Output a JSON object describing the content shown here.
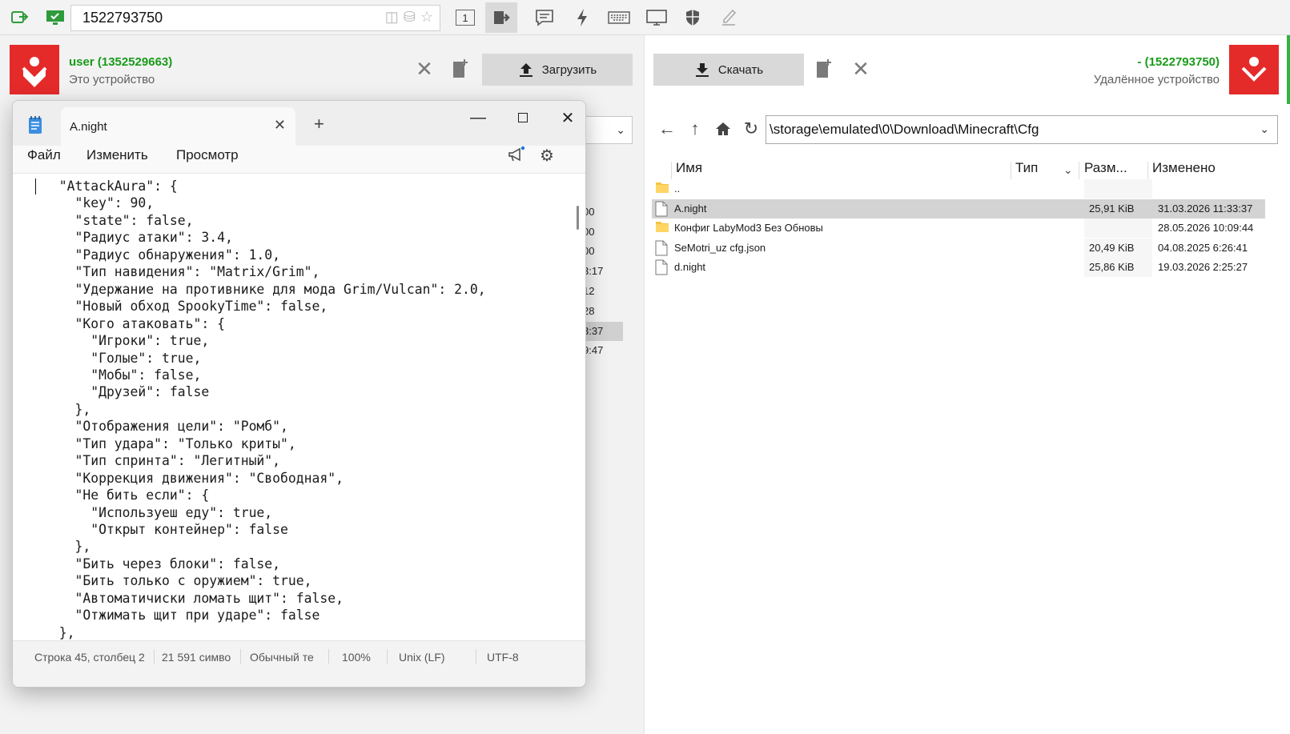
{
  "toolbar": {
    "remote_id": "1522793750",
    "icons": [
      "connection-status-icon",
      "monitor-icon",
      "screen-icon",
      "disk-icon",
      "star-icon",
      "session-number-icon",
      "file-transfer-icon",
      "chat-icon",
      "action-icon",
      "keyboard-icon",
      "display-icon",
      "shield-icon",
      "pen-icon"
    ],
    "session_number": "1"
  },
  "local": {
    "device_name": "user (1352529663)",
    "device_sub": "Это устройство",
    "upload_label": "Загрузить",
    "partial_times": [
      "00",
      "00",
      "00",
      "3:17",
      "12",
      "28",
      "3:37",
      "9:47"
    ]
  },
  "remote": {
    "device_name": "- (1522793750)",
    "device_sub": "Удалённое устройство",
    "download_label": "Скачать",
    "path": "\\storage\\emulated\\0\\Download\\Minecraft\\Cfg",
    "columns": {
      "name": "Имя",
      "type": "Тип",
      "size": "Разм...",
      "modified": "Изменено"
    },
    "files": [
      {
        "name": "..",
        "kind": "folder",
        "size": "",
        "modified": ""
      },
      {
        "name": "A.night",
        "kind": "file",
        "size": "25,91 KiB",
        "modified": "31.03.2026 11:33:37",
        "selected": true
      },
      {
        "name": "Конфиг LabyMod3 Без Обновы",
        "kind": "folder",
        "size": "",
        "modified": "28.05.2026 10:09:44"
      },
      {
        "name": "SeMotri_uz cfg.json",
        "kind": "file",
        "size": "20,49 KiB",
        "modified": "04.08.2025 6:26:41"
      },
      {
        "name": "d.night",
        "kind": "file",
        "size": "25,86 KiB",
        "modified": "19.03.2026 2:25:27"
      }
    ]
  },
  "notepad": {
    "tab_title": "A.night",
    "menu": {
      "file": "Файл",
      "edit": "Изменить",
      "view": "Просмотр"
    },
    "lines": [
      "  \"AttackAura\": {",
      "    \"key\": 90,",
      "    \"state\": false,",
      "    \"Радиус атаки\": 3.4,",
      "    \"Радиус обнаружения\": 1.0,",
      "    \"Тип навидения\": \"Matrix/Grim\",",
      "    \"Удержание на противнике для мода Grim/Vulcan\": 2.0,",
      "    \"Новый обход SpookyTime\": false,",
      "    \"Кого атаковать\": {",
      "      \"Игроки\": true,",
      "      \"Голые\": true,",
      "      \"Мобы\": false,",
      "      \"Друзей\": false",
      "    },",
      "    \"Отображения цели\": \"Ромб\",",
      "    \"Тип удара\": \"Только криты\",",
      "    \"Тип спринта\": \"Легитный\",",
      "    \"Коррекция движения\": \"Свободная\",",
      "    \"Не бить если\": {",
      "      \"Используеш еду\": true,",
      "      \"Открыт контейнер\": false",
      "    },",
      "    \"Бить через блоки\": false,",
      "    \"Бить только с оружием\": true,",
      "    \"Автоматичиски ломать щит\": false,",
      "    \"Отжимать щит при ударе\": false",
      "  },"
    ],
    "status": {
      "position": "Строка 45, столбец 2",
      "chars": "21 591 симво",
      "mode": "Обычный те",
      "zoom": "100%",
      "eol": "Unix (LF)",
      "encoding": "UTF-8"
    }
  },
  "colors": {
    "accent_red": "#e52a2a",
    "online_green": "#1a9b1a",
    "selection": "#d3d3d3"
  }
}
